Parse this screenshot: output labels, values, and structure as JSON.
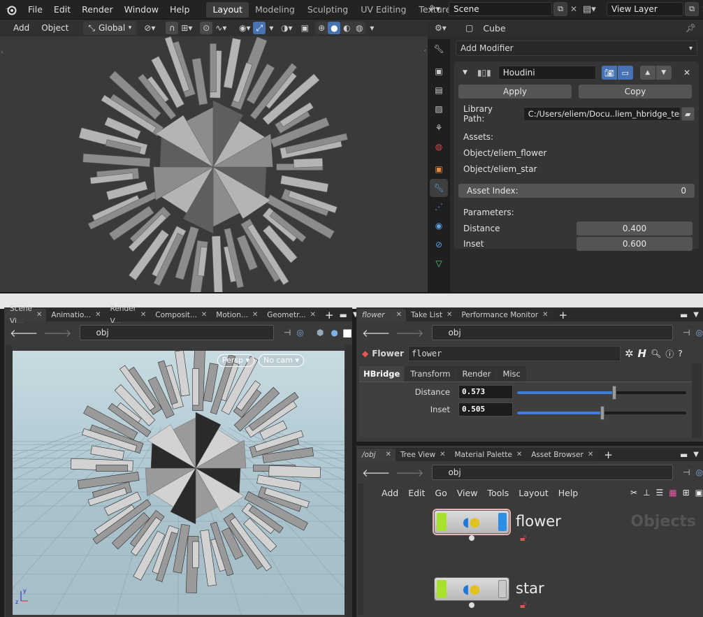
{
  "blender": {
    "menu": [
      "File",
      "Edit",
      "Render",
      "Window",
      "Help"
    ],
    "workspace_tabs": [
      {
        "label": "Layout",
        "active": true
      },
      {
        "label": "Modeling",
        "active": false
      },
      {
        "label": "Sculpting",
        "active": false
      },
      {
        "label": "UV Editing",
        "active": false
      },
      {
        "label": "Texture Paint",
        "active": false
      }
    ],
    "scene_field": "Scene",
    "view_layer_field": "View Layer",
    "viewport_header": {
      "add": "Add",
      "object": "Object",
      "orientation": "Global"
    },
    "properties": {
      "object_name": "Cube",
      "add_modifier": "Add Modifier",
      "modifier_name": "Houdini",
      "apply": "Apply",
      "copy": "Copy",
      "library_path_label": "Library Path:",
      "library_path": "C:/Users/eliem/Docu..liem_hbridge_test.hda",
      "assets_label": "Assets:",
      "assets": [
        "Object/eliem_flower",
        "Object/eliem_star"
      ],
      "asset_index_label": "Asset Index:",
      "asset_index": "0",
      "parameters_label": "Parameters:",
      "params": [
        {
          "label": "Distance",
          "value": "0.400"
        },
        {
          "label": "Inset",
          "value": "0.600"
        }
      ]
    }
  },
  "houdini": {
    "left_tabs": [
      "Scene Vi...",
      "Animatio...",
      "Render V...",
      "Composit...",
      "Motion...",
      "Geometr..."
    ],
    "left_path": "obj",
    "persp": "Persp",
    "cam": "No cam",
    "param_tabs_top": [
      "flower",
      "Take List",
      "Performance Monitor"
    ],
    "param_path": "obj",
    "node_type": "Flower",
    "node_name": "flower",
    "param_groups": [
      "HBridge",
      "Transform",
      "Render",
      "Misc"
    ],
    "params": [
      {
        "label": "Distance",
        "value": "0.573",
        "fraction": 0.573
      },
      {
        "label": "Inset",
        "value": "0.505",
        "fraction": 0.505
      }
    ],
    "net_tabs": [
      "/obj",
      "Tree View",
      "Material Palette",
      "Asset Browser"
    ],
    "net_path": "obj",
    "net_menu": [
      "Add",
      "Edit",
      "Go",
      "View",
      "Tools",
      "Layout",
      "Help"
    ],
    "net_watermark": "Objects",
    "nodes": [
      {
        "name": "flower"
      },
      {
        "name": "star"
      }
    ]
  }
}
